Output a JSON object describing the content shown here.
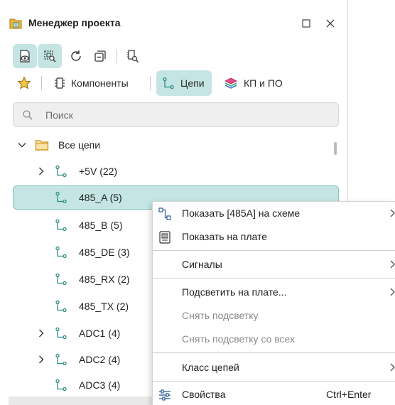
{
  "header": {
    "title": "Менеджер проекта",
    "icons": [
      "project-manager-icon",
      "maximize-icon",
      "close-icon"
    ]
  },
  "toolbar": {
    "icons": [
      "show-in-schematic-icon",
      "highlight-on-board-icon",
      "refresh-icon",
      "collapse-all-icon",
      "find-in-board-icon"
    ]
  },
  "tabs": [
    {
      "label": "",
      "icon": "star-icon"
    },
    {
      "label": "Компоненты",
      "icon": "component-icon"
    },
    {
      "label": "Цепи",
      "icon": "net-icon",
      "active": true
    },
    {
      "label": "КП и ПО",
      "icon": "layers-icon"
    }
  ],
  "search": {
    "placeholder": "Поиск"
  },
  "tree": {
    "root": "Все цепи",
    "items": [
      {
        "label": "+5V (22)",
        "expandable": true
      },
      {
        "label": "485_A (5)",
        "selected": true
      },
      {
        "label": "485_B (5)"
      },
      {
        "label": "485_DE (3)"
      },
      {
        "label": "485_RX (2)"
      },
      {
        "label": "485_TX (2)"
      },
      {
        "label": "ADC1 (4)",
        "expandable": true
      },
      {
        "label": "ADC2 (4)",
        "expandable": true
      },
      {
        "label": "ADC3 (4)"
      }
    ]
  },
  "context_menu": {
    "items": [
      {
        "label": "Показать [485A] на схеме",
        "icon": "schematic-net-icon",
        "submenu": true
      },
      {
        "label": "Показать на плате",
        "icon": "board-icon"
      },
      {
        "label": "Сигналы",
        "submenu": true
      },
      {
        "label": "Подсветить на плате...",
        "submenu": true
      },
      {
        "label": "Снять подсветку",
        "disabled": true
      },
      {
        "label": "Снять подсветку со всех",
        "disabled": true
      },
      {
        "label": "Класс цепей",
        "submenu": true
      },
      {
        "label": "Свойства",
        "icon": "properties-icon",
        "shortcut": "Ctrl+Enter"
      }
    ]
  },
  "colors": {
    "accent_bg": "#c4e5e3",
    "accent_border": "#82c2bd",
    "net_icon": "#2b8a83",
    "folder": "#e2a21e"
  }
}
